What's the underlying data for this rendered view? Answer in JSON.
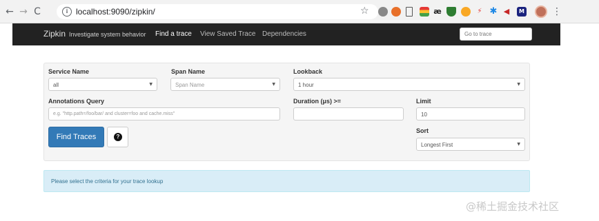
{
  "browser": {
    "back": "←",
    "forward": "→",
    "reload": "C",
    "info": "i",
    "url": "localhost:9090/zipkin/",
    "star": "☆",
    "menu": "⋮"
  },
  "navbar": {
    "brand": "Zipkin",
    "tagline": "Investigate system behavior",
    "links": [
      "Find a trace",
      "View Saved Trace",
      "Dependencies"
    ],
    "goto_placeholder": "Go to trace"
  },
  "search": {
    "service_label": "Service Name",
    "service_value": "all",
    "span_label": "Span Name",
    "span_placeholder": "Span Name",
    "lookback_label": "Lookback",
    "lookback_value": "1 hour",
    "annotations_label": "Annotations Query",
    "annotations_placeholder": "e.g. \"http.path=/foo/bar/ and cluster=foo and cache.miss\"",
    "duration_label": "Duration (μs) >=",
    "duration_value": "",
    "limit_label": "Limit",
    "limit_value": "10",
    "sort_label": "Sort",
    "sort_value": "Longest First",
    "find_button": "Find Traces",
    "help_symbol": "?"
  },
  "alert": {
    "text": "Please select the criteria for your trace lookup"
  },
  "watermark": "@稀土掘金技术社区",
  "colors": {
    "navbar_bg": "#222222",
    "primary_button": "#337ab7",
    "alert_bg": "#d9edf7",
    "alert_text": "#31708f"
  }
}
